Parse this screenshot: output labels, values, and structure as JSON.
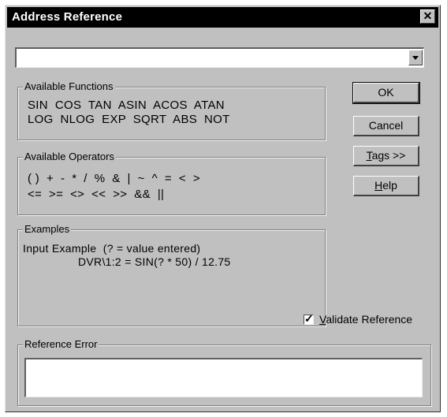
{
  "dialog": {
    "title": "Address Reference",
    "close_glyph": "✕"
  },
  "address": {
    "value": ""
  },
  "functions": {
    "legend": "Available Functions",
    "line1": "SIN  COS  TAN  ASIN  ACOS  ATAN",
    "line2": "LOG  NLOG  EXP  SQRT  ABS  NOT"
  },
  "operators": {
    "legend": "Available Operators",
    "line1": "( )  +  -  *  /  %  &  |  ~  ^  =  <  >",
    "line2": "<=  >=  <>  <<  >>  &&  ||"
  },
  "examples": {
    "legend": "Examples",
    "line1": "Input Example  (? = value entered)",
    "line2": "DVR\\1:2 = SIN(? * 50) / 12.75"
  },
  "buttons": {
    "ok": "OK",
    "cancel": "Cancel",
    "tags_first": "T",
    "tags_rest": "ags >>",
    "help_first": "H",
    "help_rest": "elp"
  },
  "validate": {
    "checked": true,
    "label_first": "V",
    "label_rest": "alidate Reference"
  },
  "reference_error": {
    "legend": "Reference Error",
    "value": ""
  },
  "colors": {
    "face": "#c0c0c0",
    "titlebar": "#000000"
  }
}
